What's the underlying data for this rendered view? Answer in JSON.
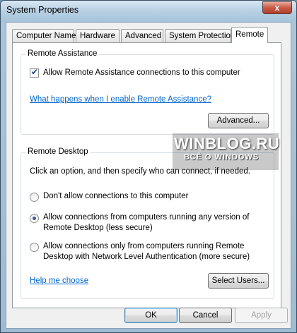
{
  "window": {
    "title": "System Properties",
    "close_glyph": "x"
  },
  "tabs": [
    {
      "label": "Computer Name"
    },
    {
      "label": "Hardware"
    },
    {
      "label": "Advanced"
    },
    {
      "label": "System Protection"
    },
    {
      "label": "Remote",
      "active": true
    }
  ],
  "remote_assistance": {
    "group_title": "Remote Assistance",
    "checkbox_label": "Allow Remote Assistance connections to this computer",
    "checkbox_checked": true,
    "help_link": "What happens when I enable Remote Assistance?",
    "advanced_button": "Advanced..."
  },
  "remote_desktop": {
    "group_title": "Remote Desktop",
    "instruction": "Click an option, and then specify who can connect, if needed.",
    "options": [
      {
        "line1": "Don't allow connections to this computer",
        "line2": "",
        "selected": false
      },
      {
        "line1": "Allow connections from computers running any version of",
        "line2": "Remote Desktop (less secure)",
        "selected": true
      },
      {
        "line1": "Allow connections only from computers running Remote",
        "line2": "Desktop with Network Level Authentication (more secure)",
        "selected": false
      }
    ],
    "help_link": "Help me choose",
    "select_users_button": "Select Users..."
  },
  "footer": {
    "ok": "OK",
    "cancel": "Cancel",
    "apply": "Apply"
  },
  "watermark": {
    "main": "WINBLOG.RU",
    "sub": "ВСЁ О WINDOWS"
  }
}
